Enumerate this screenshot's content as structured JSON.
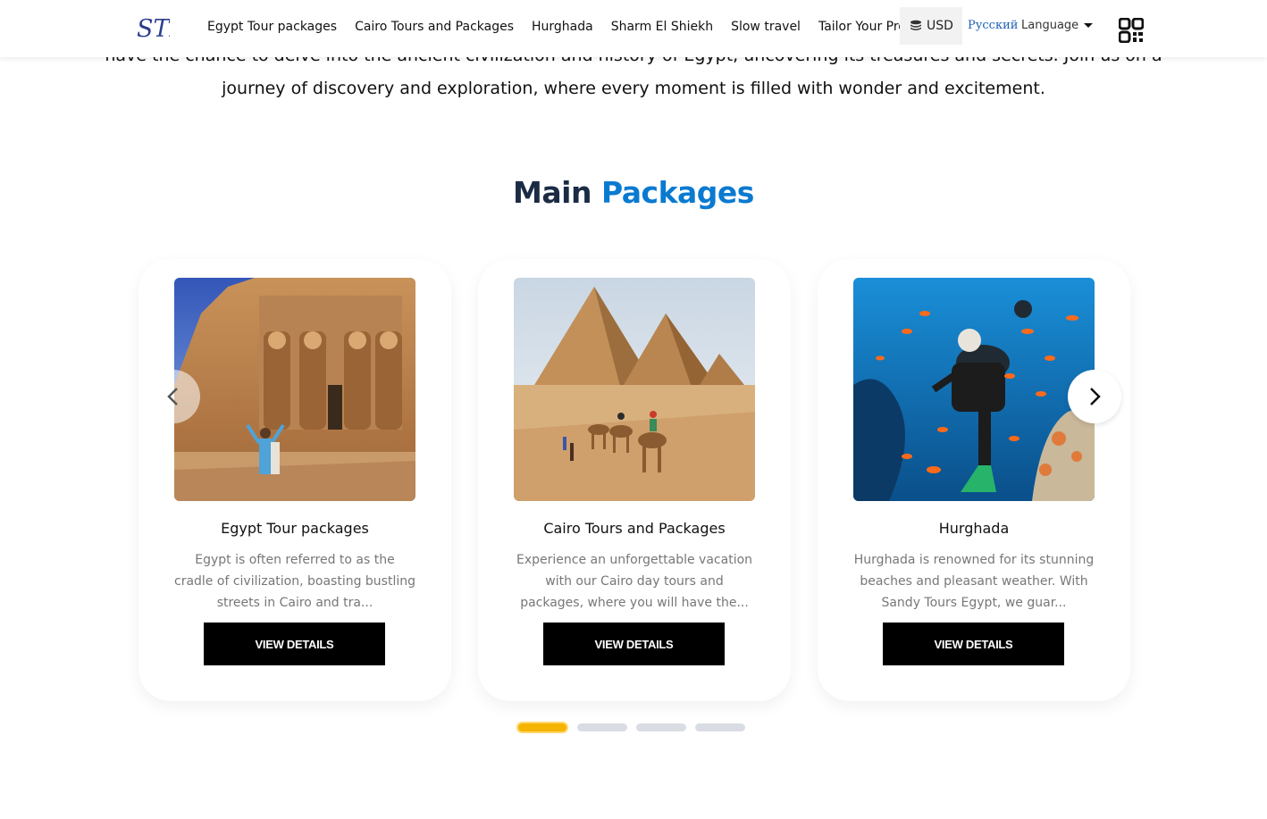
{
  "colors": {
    "accent": "#0a7ad1",
    "title_dark": "#1b2b44",
    "active_dot": "#f5b400"
  },
  "intro": {
    "line1": "have the chance to delve into the ancient civilization and history of Egypt, uncovering its treasures and secrets. Join us on a",
    "line2": "journey of discovery and exploration, where every moment is filled with wonder and excitement."
  },
  "header": {
    "logo_text": "STE",
    "nav": [
      "Egypt Tour packages",
      "Cairo Tours and Packages",
      "Hurghada",
      "Sharm El Shiekh",
      "Slow travel",
      "Tailor Your Program"
    ],
    "currency": "USD",
    "currency_icon": "coins-icon",
    "russian_link": "Русский",
    "language_label": "Language",
    "qr_icon": "qr-code-icon"
  },
  "section": {
    "title_part1": "Main",
    "title_part2": "Packages"
  },
  "cards": [
    {
      "title": "Egypt Tour packages",
      "description": "Egypt is often referred to as the cradle of civilization, boasting bustling streets in Cairo and tra...",
      "button": "VIEW DETAILS",
      "image": "abu-simbel-temple"
    },
    {
      "title": "Cairo Tours and Packages",
      "description": "Experience an unforgettable vacation with our Cairo day tours and packages, where you will have the...",
      "button": "VIEW DETAILS",
      "image": "giza-pyramids-camels"
    },
    {
      "title": "Hurghada",
      "description": "Hurghada is renowned for its stunning beaches and pleasant weather. With Sandy Tours Egypt, we guar...",
      "button": "VIEW DETAILS",
      "image": "scuba-diver-coral-reef"
    }
  ],
  "carousel": {
    "prev_icon": "chevron-left-icon",
    "next_icon": "chevron-right-icon",
    "dot_count": 4,
    "active_index": 0
  }
}
